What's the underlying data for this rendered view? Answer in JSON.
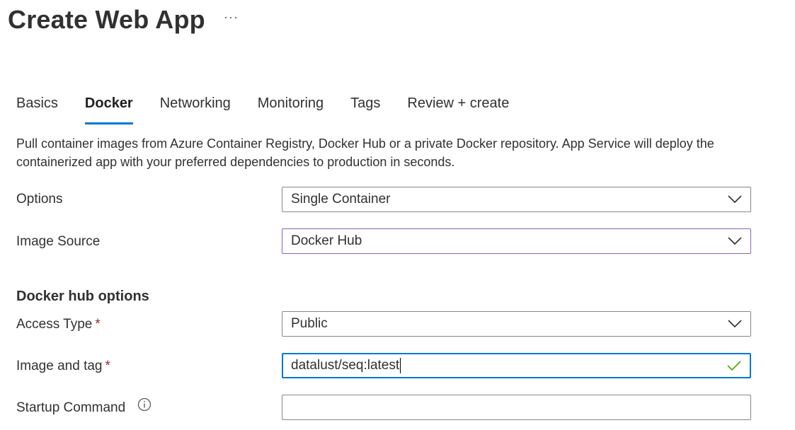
{
  "page": {
    "title": "Create Web App",
    "more_label": "···"
  },
  "tabs": [
    {
      "label": "Basics",
      "active": false
    },
    {
      "label": "Docker",
      "active": true
    },
    {
      "label": "Networking",
      "active": false
    },
    {
      "label": "Monitoring",
      "active": false
    },
    {
      "label": "Tags",
      "active": false
    },
    {
      "label": "Review + create",
      "active": false
    }
  ],
  "description": "Pull container images from Azure Container Registry, Docker Hub or a private Docker repository. App Service will deploy the containerized app with your preferred dependencies to production in seconds.",
  "form": {
    "options": {
      "label": "Options",
      "value": "Single Container"
    },
    "image_source": {
      "label": "Image Source",
      "value": "Docker Hub"
    },
    "section_title": "Docker hub options",
    "access_type": {
      "label": "Access Type",
      "required_mark": "*",
      "value": "Public"
    },
    "image_tag": {
      "label": "Image and tag",
      "required_mark": "*",
      "value": "datalust/seq:latest"
    },
    "startup_command": {
      "label": "Startup Command",
      "value": ""
    }
  },
  "icons": {
    "dropdown": "chevron-down-icon",
    "valid": "checkmark-icon",
    "info": "info-icon"
  },
  "colors": {
    "accent": "#0078d4",
    "required": "#a4262c",
    "valid": "#57a300",
    "focus_purple": "#8764b8"
  }
}
